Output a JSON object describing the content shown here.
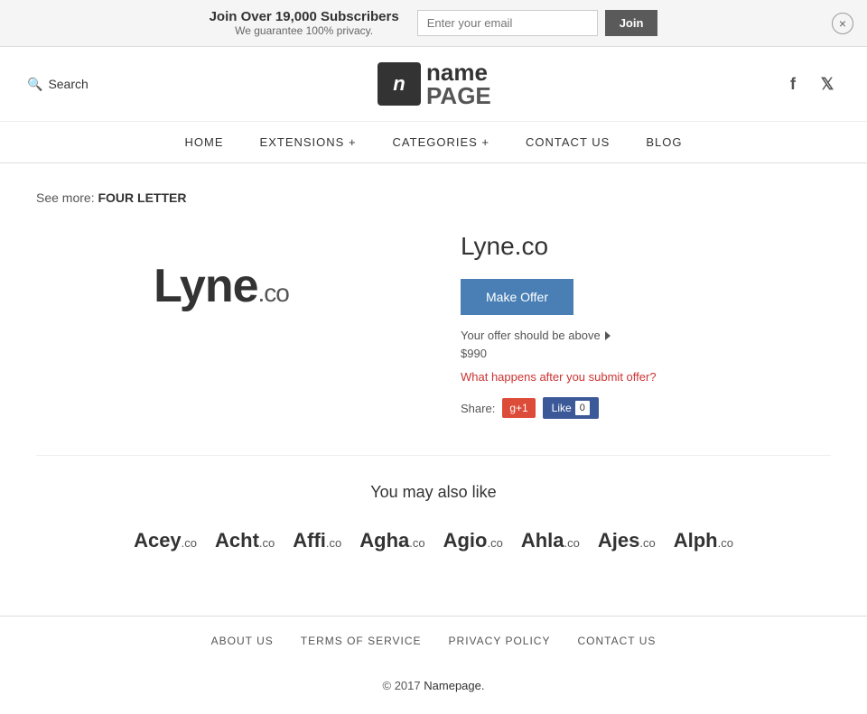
{
  "banner": {
    "main_text": "Join Over 19,000 Subscribers",
    "sub_text": "We guarantee 100% privacy.",
    "email_placeholder": "Enter your email",
    "join_label": "Join",
    "close_label": "×"
  },
  "header": {
    "search_label": "Search",
    "logo_icon": "n",
    "logo_name": "name",
    "logo_page": "PAGE",
    "facebook_icon": "f",
    "twitter_icon": "t"
  },
  "nav": {
    "items": [
      {
        "label": "HOME",
        "id": "home"
      },
      {
        "label": "EXTENSIONS +",
        "id": "extensions"
      },
      {
        "label": "CATEGORIES +",
        "id": "categories"
      },
      {
        "label": "CONTACT US",
        "id": "contact"
      },
      {
        "label": "BLOG",
        "id": "blog"
      }
    ]
  },
  "see_more": {
    "prefix": "See more:",
    "link": "FOUR LETTER"
  },
  "domain": {
    "name": "Lyne",
    "tld": ".co",
    "full": "Lyne.co",
    "make_offer_label": "Make Offer",
    "offer_info": "Your offer should be above",
    "offer_price": "$990",
    "offer_link": "What happens after you submit offer?",
    "share_label": "Share:",
    "google_plus_label": "g+1",
    "facebook_like_label": "Like",
    "facebook_count": "0"
  },
  "also_like": {
    "title": "You may also like",
    "items": [
      {
        "name": "Acey",
        "tld": ".co"
      },
      {
        "name": "Acht",
        "tld": ".co"
      },
      {
        "name": "Affi",
        "tld": ".co"
      },
      {
        "name": "Agha",
        "tld": ".co"
      },
      {
        "name": "Agio",
        "tld": ".co"
      },
      {
        "name": "Ahla",
        "tld": ".co"
      },
      {
        "name": "Ajes",
        "tld": ".co"
      },
      {
        "name": "Alph",
        "tld": ".co"
      }
    ]
  },
  "footer": {
    "links": [
      {
        "label": "ABOUT US",
        "id": "about"
      },
      {
        "label": "TERMS OF SERVICE",
        "id": "terms"
      },
      {
        "label": "PRIVACY POLICY",
        "id": "privacy"
      },
      {
        "label": "CONTACT US",
        "id": "contact"
      }
    ],
    "copy_prefix": "© 2017",
    "copy_brand": "Namepage.",
    "copy_suffix": ""
  }
}
